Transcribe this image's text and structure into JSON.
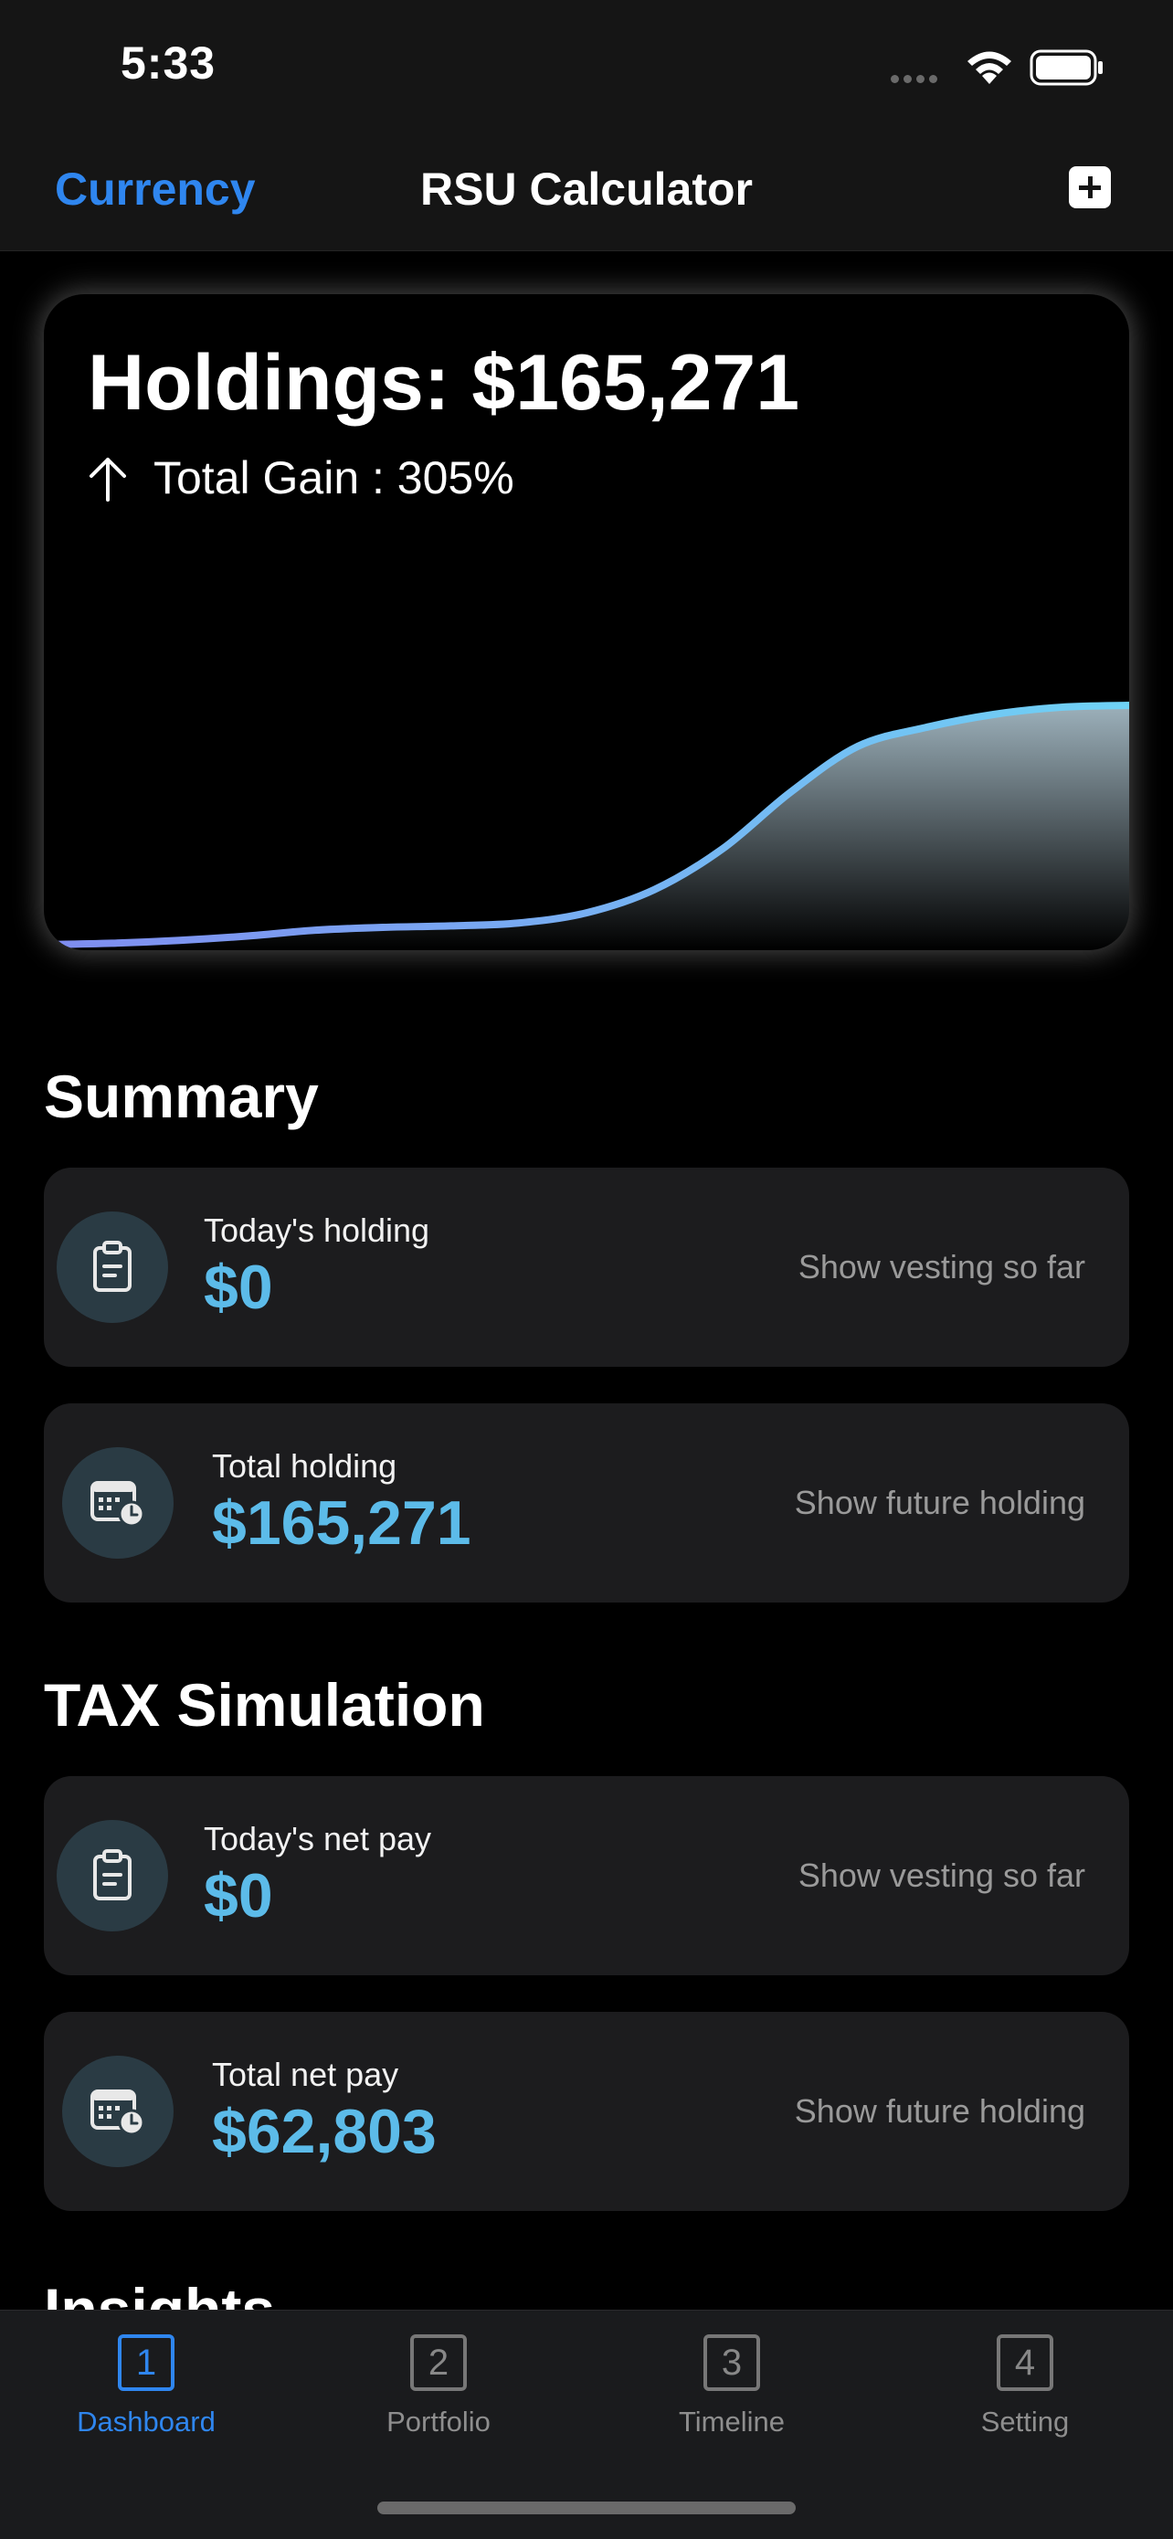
{
  "status_bar": {
    "time": "5:33"
  },
  "nav": {
    "left_label": "Currency",
    "title": "RSU Calculator",
    "add_icon": "plus-square-icon"
  },
  "holdings": {
    "title": "Holdings: $165,271",
    "gain": "Total Gain : 305%"
  },
  "chart_data": {
    "type": "area",
    "title": "",
    "xlabel": "",
    "ylabel": "",
    "x": [
      0,
      1,
      2,
      3,
      4,
      5,
      6,
      7,
      8,
      9,
      10,
      11,
      12,
      13,
      14,
      15,
      16
    ],
    "series": [
      {
        "values": [
          0,
          1,
          3,
          6,
          10,
          12,
          13,
          15,
          22,
          38,
          66,
          105,
          137,
          150,
          159,
          164,
          165.3
        ]
      }
    ],
    "colors": {
      "line_start": "#7f8cf0",
      "line_end": "#6fd2f5",
      "fill_top": "#b8d0dc"
    }
  },
  "summary": {
    "title": "Summary",
    "rows": [
      {
        "label": "Today's holding",
        "value": "$0",
        "link": "Show vesting so far",
        "icon": "clipboard-icon"
      },
      {
        "label": "Total holding",
        "value": "$165,271",
        "link": "Show future holding",
        "icon": "calendar-clock-icon"
      }
    ]
  },
  "tax": {
    "title": "TAX Simulation",
    "rows": [
      {
        "label": "Today's net pay",
        "value": "$0",
        "link": "Show vesting so far",
        "icon": "clipboard-icon"
      },
      {
        "label": "Total net pay",
        "value": "$62,803",
        "link": "Show future holding",
        "icon": "calendar-clock-icon"
      }
    ]
  },
  "insights": {
    "title": "Insights"
  },
  "tabs": [
    {
      "number": "1",
      "label": "Dashboard",
      "active": true
    },
    {
      "number": "2",
      "label": "Portfolio",
      "active": false
    },
    {
      "number": "3",
      "label": "Timeline",
      "active": false
    },
    {
      "number": "4",
      "label": "Setting",
      "active": false
    }
  ]
}
